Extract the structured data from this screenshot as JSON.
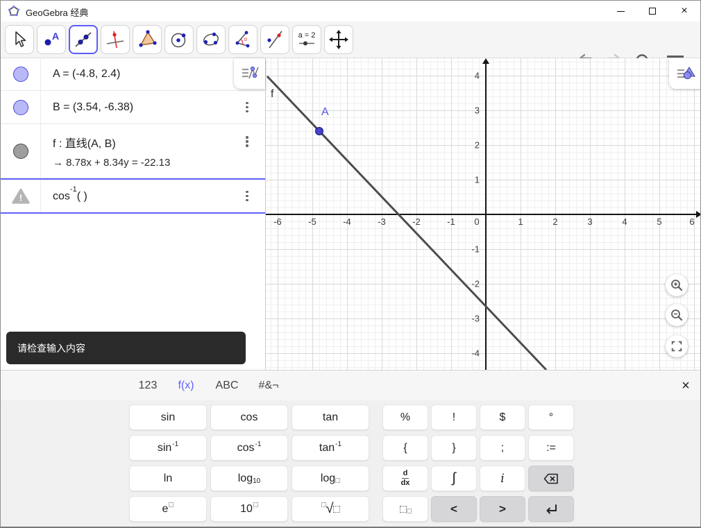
{
  "titlebar": {
    "title": "GeoGebra 经典"
  },
  "toolbar": {
    "tools": [
      "move",
      "point",
      "line",
      "perpendicular-line",
      "polygon",
      "circle-with-center",
      "ellipse",
      "angle",
      "reflect-about-line",
      "slider",
      "move-graphics-view"
    ],
    "selected_tool": "line",
    "slider_label": "a = 2"
  },
  "algebra": {
    "row_a": "A = (-4.8, 2.4)",
    "row_b": "B = (3.54, -6.38)",
    "row_f_def": "f : 直线(A, B)",
    "row_f_arrow": "→",
    "row_f_value": "8.78x + 8.34y = -22.13",
    "row_err_base": "cos",
    "row_err_sup": "-1",
    "row_err_rest": "( )"
  },
  "tooltip": {
    "text": "请检查输入内容"
  },
  "graphics": {
    "line_label": "f",
    "point_label": "A",
    "points": {
      "A": "(-4.8, 2.4)",
      "B": "(3.54, -6.38)"
    },
    "line_equation": "8.78x + 8.34y = -22.13",
    "x_ticks": [
      {
        "label": "-6",
        "x": 17
      },
      {
        "label": "-5",
        "x": 67
      },
      {
        "label": "-4",
        "x": 117
      },
      {
        "label": "-3",
        "x": 167
      },
      {
        "label": "-2",
        "x": 217
      },
      {
        "label": "-1",
        "x": 267
      },
      {
        "label": "0",
        "x": 304
      },
      {
        "label": "1",
        "x": 367
      },
      {
        "label": "2",
        "x": 417
      },
      {
        "label": "3",
        "x": 467
      },
      {
        "label": "4",
        "x": 517
      },
      {
        "label": "5",
        "x": 567
      },
      {
        "label": "6",
        "x": 614
      }
    ],
    "y_ticks": [
      {
        "label": "4",
        "y": 25
      },
      {
        "label": "3",
        "y": 75
      },
      {
        "label": "2",
        "y": 125
      },
      {
        "label": "1",
        "y": 175
      },
      {
        "label": "-1",
        "y": 275
      },
      {
        "label": "-2",
        "y": 325
      },
      {
        "label": "-3",
        "y": 375
      },
      {
        "label": "-4",
        "y": 425
      }
    ]
  },
  "kb": {
    "tabs": [
      "123",
      "f(x)",
      "ABC",
      "#&¬"
    ],
    "active_tab": "f(x)",
    "close": "×",
    "trig": [
      "sin",
      "cos",
      "tan"
    ],
    "inv_sup": "-1",
    "ln": "ln",
    "log": "log",
    "log_sub": "10",
    "e": "e",
    "ten": "10",
    "sqrt": "√",
    "sym1": [
      "%",
      "!",
      "$",
      "°"
    ],
    "sym2": [
      "{",
      "}",
      ";",
      ":="
    ],
    "ddx_top": "d",
    "ddx_bot": "dx",
    "integral": "∫",
    "imag": "i",
    "left": "<",
    "right": ">"
  }
}
